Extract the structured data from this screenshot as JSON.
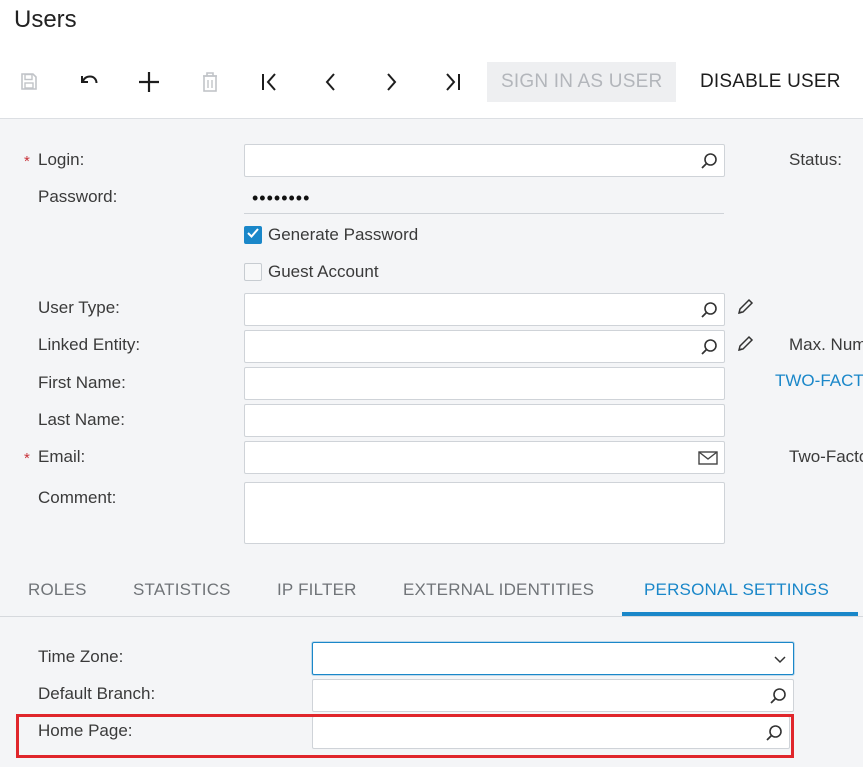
{
  "window": {
    "title": "Users"
  },
  "toolbar": {
    "save": "save-icon",
    "undo": "undo-icon",
    "add": "plus-icon",
    "delete": "trash-icon",
    "first": "first-record-icon",
    "prev": "chevron-left-icon",
    "next": "chevron-right-icon",
    "last": "last-record-icon",
    "sign_in_as_user": "SIGN IN AS USER",
    "disable_user": "DISABLE USER"
  },
  "form": {
    "login_label": "Login:",
    "login_value": "",
    "password_label": "Password:",
    "password_value": "••••••••",
    "generate_password_label": "Generate Password",
    "generate_password_checked": true,
    "guest_account_label": "Guest Account",
    "guest_account_checked": false,
    "user_type_label": "User Type:",
    "user_type_value": "",
    "linked_entity_label": "Linked Entity:",
    "linked_entity_value": "",
    "first_name_label": "First Name:",
    "first_name_value": "",
    "last_name_label": "Last Name:",
    "last_name_value": "",
    "email_label": "Email:",
    "email_value": "",
    "comment_label": "Comment:",
    "comment_value": "",
    "required_marker": "*"
  },
  "right_panel": {
    "status_label": "Status:",
    "max_num_label": "Max. Num",
    "two_factor_link": "TWO-FACT",
    "two_factor_label": "Two-Facto"
  },
  "tabs": [
    {
      "label": "ROLES",
      "active": false
    },
    {
      "label": "STATISTICS",
      "active": false
    },
    {
      "label": "IP FILTER",
      "active": false
    },
    {
      "label": "EXTERNAL IDENTITIES",
      "active": false
    },
    {
      "label": "PERSONAL SETTINGS",
      "active": true
    }
  ],
  "personal_settings": {
    "time_zone_label": "Time Zone:",
    "time_zone_value": "",
    "default_branch_label": "Default Branch:",
    "default_branch_value": "",
    "home_page_label": "Home Page:",
    "home_page_value": ""
  },
  "colors": {
    "accent": "#1a87c9",
    "required": "#c8323a",
    "highlight": "#e0262b",
    "form_bg": "#f4f5f7"
  }
}
